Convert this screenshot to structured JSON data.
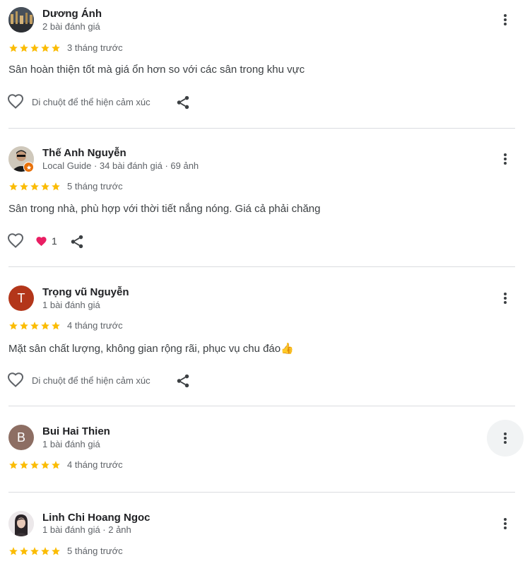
{
  "reviews": [
    {
      "name": "Dương Ánh",
      "meta": "2 bài đánh giá",
      "rating": 5,
      "date": "3 tháng trước",
      "text": "Sân hoàn thiện tốt mà giá ổn hơn so với các sân trong khu vực",
      "react_hint": "Di chuột để thể hiện cảm xúc",
      "avatar": "photo"
    },
    {
      "name": "Thế Anh Nguyễn",
      "meta": "Local Guide · 34 bài đánh giá · 69 ảnh",
      "rating": 5,
      "date": "5 tháng trước",
      "text": "Sân trong nhà, phù hợp với thời tiết nắng nóng. Giá cả phải chăng",
      "reaction_count": "1",
      "avatar": "photo"
    },
    {
      "name": "Trọng vũ Nguyễn",
      "meta": "1 bài đánh giá",
      "rating": 5,
      "date": "4 tháng trước",
      "text": "Mặt sân chất lượng, không gian rộng rãi, phục vụ chu đáo👍",
      "react_hint": "Di chuột để thể hiện cảm xúc",
      "avatar_letter": "T",
      "avatar_color": "#b3361a"
    },
    {
      "name": "Bui Hai Thien",
      "meta": "1 bài đánh giá",
      "rating": 5,
      "date": "4 tháng trước",
      "avatar_letter": "B",
      "avatar_color": "#8d6e63"
    },
    {
      "name": "Linh Chi Hoang Ngoc",
      "meta": "1 bài đánh giá · 2 ảnh",
      "rating": 5,
      "date": "5 tháng trước",
      "avatar": "photo"
    }
  ],
  "colors": {
    "star": "#fbbc04",
    "heart_reaction": "#e91e63",
    "icon": "#5f6368"
  }
}
